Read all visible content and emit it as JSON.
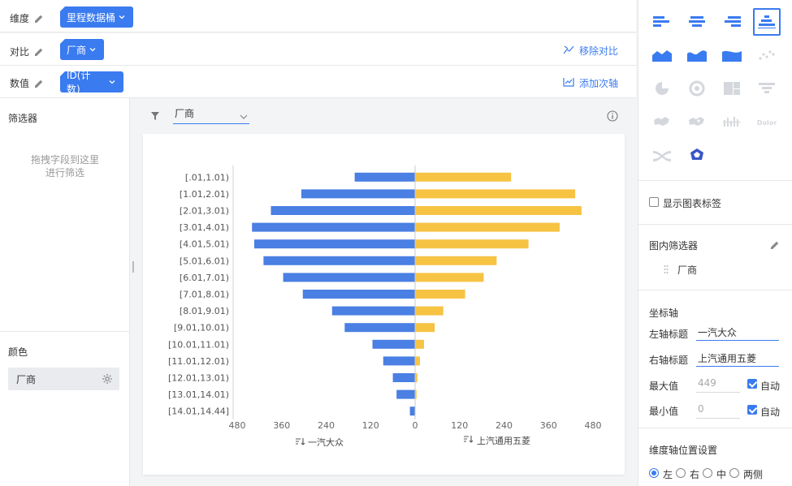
{
  "config": {
    "dimension": {
      "label": "维度",
      "value": "里程数据桶"
    },
    "compare": {
      "label": "对比",
      "value": "厂商",
      "action": "移除对比"
    },
    "metric": {
      "label": "数值",
      "value": "ID(计数)",
      "action": "添加次轴"
    }
  },
  "left_panel": {
    "filter_title": "筛选器",
    "drop_hint_line1": "拖拽字段到这里",
    "drop_hint_line2": "进行筛选",
    "color_title": "颜色",
    "color_field": "厂商"
  },
  "filter_bar": {
    "selected": "厂商"
  },
  "chart_data": {
    "type": "bar",
    "orientation": "horizontal-butterfly",
    "categories": [
      "[.01,1.01)",
      "[1.01,2.01)",
      "[2.01,3.01)",
      "[3.01,4.01)",
      "[4.01,5.01)",
      "[5.01,6.01)",
      "[6.01,7.01)",
      "[7.01,8.01)",
      "[8.01,9.01)",
      "[9.01,10.01)",
      "[10.01,11.01)",
      "[11.01,12.01)",
      "[12.01,13.01)",
      "[13.01,14.01)",
      "[14.01,14.44]"
    ],
    "series": [
      {
        "name": "一汽大众",
        "side": "left",
        "color": "#4a7fe3",
        "values": [
          163,
          307,
          389,
          440,
          434,
          409,
          356,
          303,
          224,
          190,
          115,
          86,
          60,
          50,
          14
        ]
      },
      {
        "name": "上汽通用五菱",
        "side": "right",
        "color": "#f6c343",
        "values": [
          259,
          432,
          449,
          390,
          306,
          220,
          185,
          135,
          76,
          53,
          24,
          13,
          6,
          4,
          1
        ]
      }
    ],
    "left_ticks": [
      "480",
      "360",
      "240",
      "120",
      "0"
    ],
    "right_ticks": [
      "120",
      "240",
      "360",
      "480"
    ],
    "xlim": [
      0,
      480
    ]
  },
  "right_panel": {
    "show_labels": "显示图表标签",
    "inner_filter_title": "图内筛选器",
    "inner_filter_field": "厂商",
    "axis_title": "坐标轴",
    "left_axis_label": "左轴标题",
    "left_axis_value": "一汽大众",
    "right_axis_label": "右轴标题",
    "right_axis_value": "上汽通用五菱",
    "max_label": "最大值",
    "max_value": "449",
    "min_label": "最小值",
    "min_value": "0",
    "auto_label": "自动",
    "dim_axis_title": "维度轴位置设置",
    "pos_left": "左",
    "pos_right": "右",
    "pos_center": "中",
    "pos_both": "两侧",
    "chart_types": [
      "bar-left-icon",
      "bar-center-icon",
      "bar-right-icon",
      "butterfly-bar-icon",
      "area-mountain-icon",
      "area-wave-icon",
      "area-fill-icon",
      "scatter-icon",
      "pie-icon",
      "ring-icon",
      "treemap-icon",
      "funnel-icon",
      "map-icon",
      "map-dot-icon",
      "bar-range-icon",
      "word-cloud-icon",
      "sankey-icon",
      "radar-icon"
    ],
    "word_cloud_text": "Dolor"
  }
}
